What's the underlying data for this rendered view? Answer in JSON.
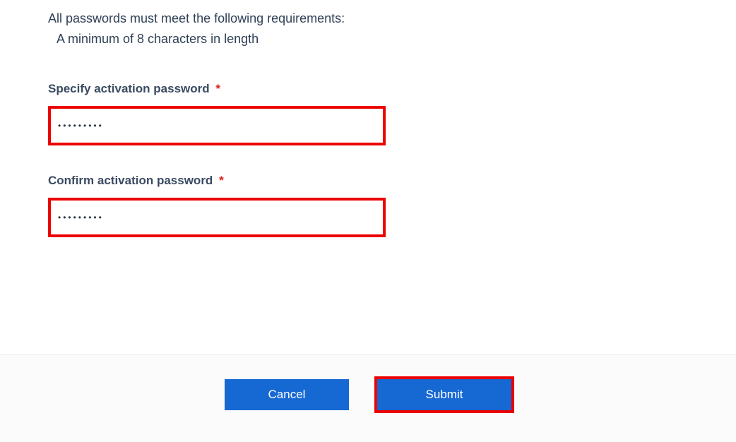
{
  "requirements": {
    "intro": "All passwords must meet the following requirements:",
    "items": [
      "A minimum of 8 characters in length"
    ]
  },
  "fields": {
    "password": {
      "label": "Specify activation password",
      "required_mark": "*",
      "value": "•••••••••"
    },
    "confirm": {
      "label": "Confirm activation password",
      "required_mark": "*",
      "value": "•••••••••"
    }
  },
  "actions": {
    "cancel": "Cancel",
    "submit": "Submit"
  }
}
